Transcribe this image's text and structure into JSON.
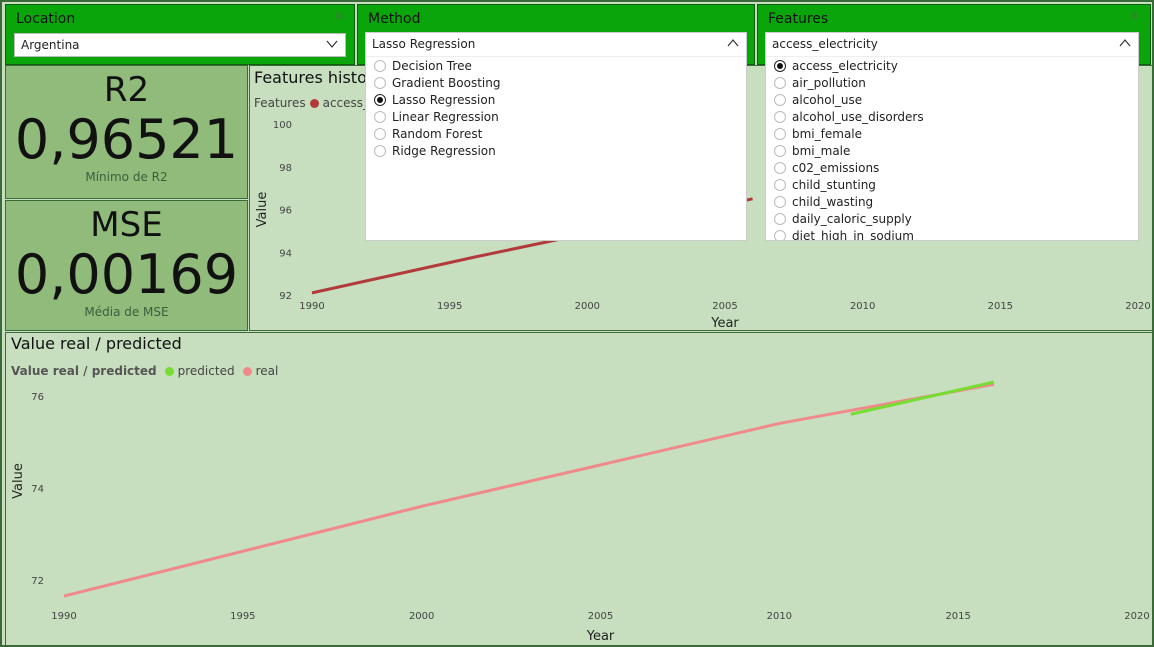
{
  "slicers": {
    "location": {
      "title": "Location",
      "value": "Argentina"
    },
    "method": {
      "title": "Method",
      "value": "Lasso Regression",
      "options": [
        "Decision Tree",
        "Gradient Boosting",
        "Lasso Regression",
        "Linear Regression",
        "Random Forest",
        "Ridge Regression"
      ],
      "selected": "Lasso Regression"
    },
    "features": {
      "title": "Features",
      "value": "access_electricity",
      "options": [
        "access_electricity",
        "air_pollution",
        "alcohol_use",
        "alcohol_use_disorders",
        "bmi_female",
        "bmi_male",
        "c02_emissions",
        "child_stunting",
        "child_wasting",
        "daily_caloric_supply",
        "diet_high_in_sodium"
      ],
      "selected": "access_electricity"
    }
  },
  "kpis": {
    "r2": {
      "title": "R2",
      "value": "0,96521",
      "label": "Mínimo de R2"
    },
    "mse": {
      "title": "MSE",
      "value": "0,00169",
      "label": "Média de MSE"
    }
  },
  "colors": {
    "header_green": "#0aa50a",
    "kpi_bg": "#90bb7a",
    "panel_bg": "#c7dfbf",
    "features_line": "#b23a3a",
    "predicted": "#77dd33",
    "real": "#f08a8a"
  },
  "chart_data": [
    {
      "type": "line",
      "title": "Features histor",
      "legend_title": "Features",
      "xlabel": "Year",
      "ylabel": "Value",
      "xlim": [
        1990,
        2020
      ],
      "ylim": [
        92,
        100
      ],
      "xticks": [
        1990,
        1995,
        2000,
        2005,
        2010,
        2015,
        2020
      ],
      "yticks": [
        92,
        94,
        96,
        98,
        100
      ],
      "series": [
        {
          "name": "access_e",
          "x": [
            1990,
            1996,
            2006
          ],
          "y": [
            92.1,
            93.8,
            96.5
          ]
        }
      ]
    },
    {
      "type": "line",
      "title": "Value real / predicted",
      "legend_title": "Value real / predicted",
      "xlabel": "Year",
      "ylabel": "Value",
      "xlim": [
        1990,
        2020
      ],
      "ylim": [
        71.5,
        76.8
      ],
      "xticks": [
        1990,
        1995,
        2000,
        2005,
        2010,
        2015,
        2020
      ],
      "yticks": [
        72,
        74,
        76
      ],
      "series": [
        {
          "name": "predicted",
          "x": [
            2012,
            2016
          ],
          "y": [
            75.6,
            76.3
          ]
        },
        {
          "name": "real",
          "x": [
            1990,
            2000,
            2010,
            2016
          ],
          "y": [
            71.65,
            73.6,
            75.4,
            76.25
          ]
        }
      ]
    }
  ]
}
